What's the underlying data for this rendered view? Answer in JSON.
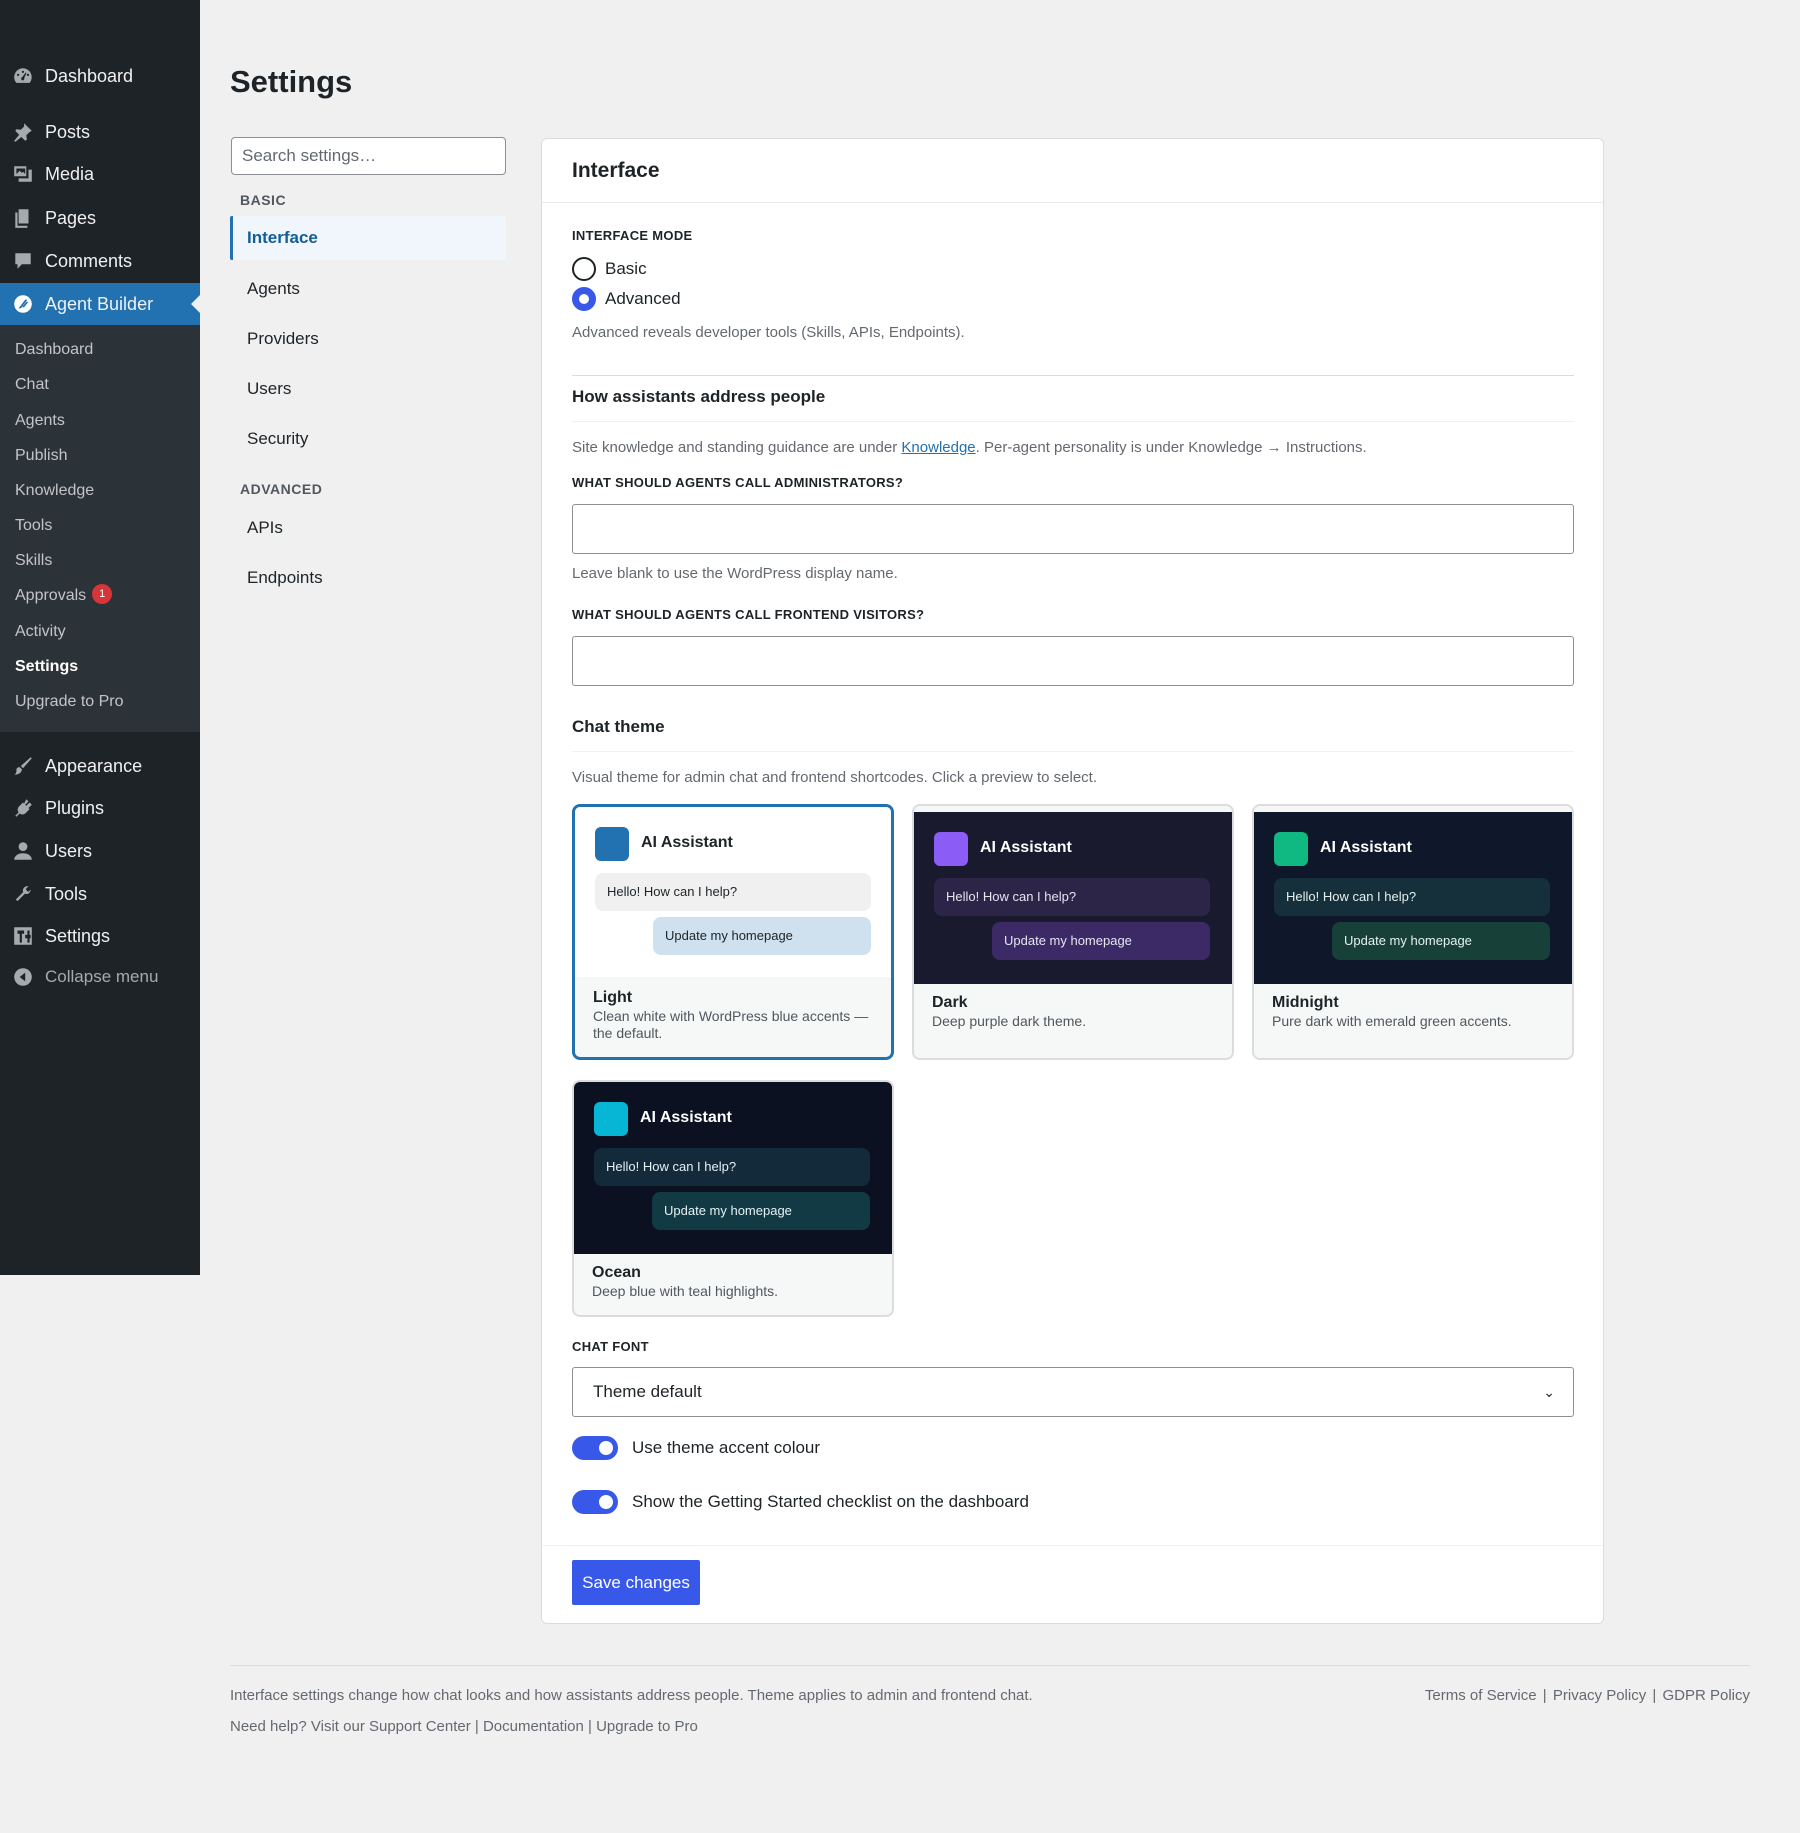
{
  "admin_menu": {
    "top": [
      {
        "label": "Dashboard",
        "icon": "dashboard-icon"
      },
      {
        "label": "Posts",
        "icon": "pushpin-icon"
      },
      {
        "label": "Media",
        "icon": "media-icon"
      },
      {
        "label": "Pages",
        "icon": "pages-icon"
      },
      {
        "label": "Comments",
        "icon": "comment-icon"
      },
      {
        "label": "Agent Builder",
        "icon": "agent-builder-icon"
      }
    ],
    "submenu": [
      "Dashboard",
      "Chat",
      "Agents",
      "Publish",
      "Knowledge",
      "Tools",
      "Skills",
      "Approvals",
      "Activity",
      "Settings",
      "Upgrade to Pro"
    ],
    "approvals_badge": "1",
    "bottom": [
      {
        "label": "Appearance",
        "icon": "paintbrush-icon"
      },
      {
        "label": "Plugins",
        "icon": "plugin-icon"
      },
      {
        "label": "Users",
        "icon": "user-icon"
      },
      {
        "label": "Tools",
        "icon": "wrench-icon"
      },
      {
        "label": "Settings",
        "icon": "settings-icon"
      },
      {
        "label": "Collapse menu",
        "icon": "collapse-icon"
      }
    ]
  },
  "page_title": "Settings",
  "search_placeholder": "Search settings…",
  "settings_nav": {
    "basic_label": "BASIC",
    "basic": [
      "Interface",
      "Agents",
      "Providers",
      "Users",
      "Security"
    ],
    "advanced_label": "ADVANCED",
    "advanced": [
      "APIs",
      "Endpoints"
    ]
  },
  "panel": {
    "title": "Interface",
    "interface_mode_label": "INTERFACE MODE",
    "mode_options": [
      "Basic",
      "Advanced"
    ],
    "selected_mode": "Advanced",
    "mode_help": "Advanced reveals developer tools (Skills, APIs, Endpoints).",
    "address_title": "How assistants address people",
    "address_help_pre": "Site knowledge and standing guidance are under ",
    "address_help_link": "Knowledge",
    "address_help_post": ". Per-agent personality is under Knowledge → Instructions.",
    "admin_call_label": "WHAT SHOULD AGENTS CALL ADMINISTRATORS?",
    "admin_call_value": "",
    "admin_call_help": "Leave blank to use the WordPress display name.",
    "visitor_call_label": "WHAT SHOULD AGENTS CALL FRONTEND VISITORS?",
    "visitor_call_value": "",
    "chat_theme_title": "Chat theme",
    "chat_theme_help": "Visual theme for admin chat and frontend shortcodes. Click a preview to select.",
    "themes": [
      {
        "name": "Light",
        "desc": "Clean white with WordPress blue accents — the default.",
        "preview_title": "AI Assistant",
        "greeting": "Hello! How can I help?",
        "user_msg": "Update my homepage",
        "accent": "#2271b1",
        "selected": true
      },
      {
        "name": "Dark",
        "desc": "Deep purple dark theme.",
        "preview_title": "AI Assistant",
        "greeting": "Hello! How can I help?",
        "user_msg": "Update my homepage",
        "accent": "#8b5cf6",
        "selected": false
      },
      {
        "name": "Midnight",
        "desc": "Pure dark with emerald green accents.",
        "preview_title": "AI Assistant",
        "greeting": "Hello! How can I help?",
        "user_msg": "Update my homepage",
        "accent": "#10b981",
        "selected": false
      },
      {
        "name": "Ocean",
        "desc": "Deep blue with teal highlights.",
        "preview_title": "AI Assistant",
        "greeting": "Hello! How can I help?",
        "user_msg": "Update my homepage",
        "accent": "#06b6d4",
        "selected": false
      }
    ],
    "chat_font_label": "CHAT FONT",
    "chat_font_value": "Theme default",
    "toggles": [
      {
        "label": "Use theme accent colour",
        "on": true
      },
      {
        "label": "Show the Getting Started checklist on the dashboard",
        "on": true
      }
    ],
    "save_label": "Save changes"
  },
  "footer": {
    "note": "Interface settings change how chat looks and how assistants address people. Theme applies to admin and frontend chat.",
    "help_prefix": "Need help? Visit our ",
    "help_links": [
      "Support Center",
      "Documentation",
      "Upgrade to Pro"
    ],
    "legal_links": [
      "Terms of Service",
      "Privacy Policy",
      "GDPR Policy"
    ]
  },
  "colors": {
    "admin_bar": "#1d2327",
    "submenu_bg": "#2c3338",
    "wp_blue": "#2271b1",
    "primary_button": "#3858e9",
    "badge_red": "#d63638"
  }
}
